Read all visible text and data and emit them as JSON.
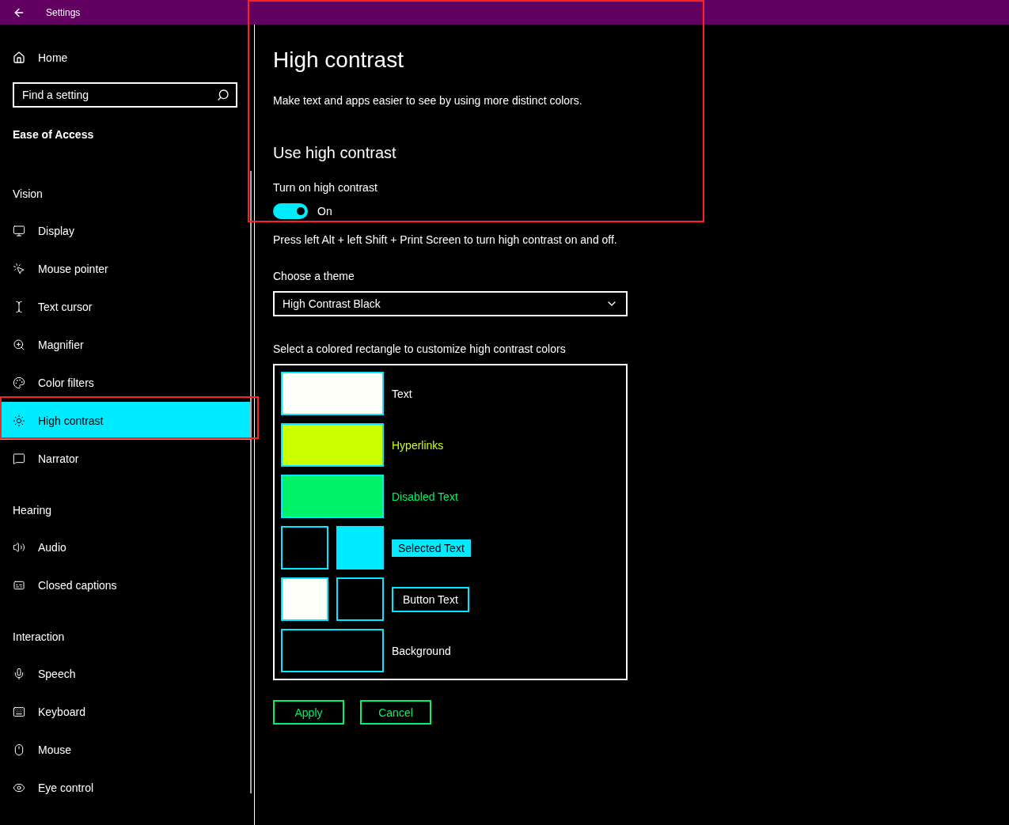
{
  "window": {
    "title": "Settings"
  },
  "sidebar": {
    "home": "Home",
    "search": {
      "placeholder": "Find a setting"
    },
    "category": "Ease of Access",
    "groups": [
      {
        "heading": "Vision",
        "items": [
          {
            "label": "Display",
            "selected": false
          },
          {
            "label": "Mouse pointer",
            "selected": false
          },
          {
            "label": "Text cursor",
            "selected": false
          },
          {
            "label": "Magnifier",
            "selected": false
          },
          {
            "label": "Color filters",
            "selected": false
          },
          {
            "label": "High contrast",
            "selected": true
          },
          {
            "label": "Narrator",
            "selected": false
          }
        ]
      },
      {
        "heading": "Hearing",
        "items": [
          {
            "label": "Audio",
            "selected": false
          },
          {
            "label": "Closed captions",
            "selected": false
          }
        ]
      },
      {
        "heading": "Interaction",
        "items": [
          {
            "label": "Speech",
            "selected": false
          },
          {
            "label": "Keyboard",
            "selected": false
          },
          {
            "label": "Mouse",
            "selected": false
          },
          {
            "label": "Eye control",
            "selected": false
          }
        ]
      }
    ]
  },
  "page": {
    "title": "High contrast",
    "description": "Make text and apps easier to see by using more distinct colors.",
    "section": "Use high contrast",
    "toggle": {
      "label": "Turn on high contrast",
      "on": true,
      "state_text": "On"
    },
    "hint": "Press left Alt + left Shift + Print Screen to turn high contrast on and off.",
    "theme": {
      "label": "Choose a theme",
      "value": "High Contrast Black"
    },
    "colors_label": "Select a colored rectangle to customize high contrast colors",
    "color_rows": [
      {
        "kind": "single",
        "label": "Text",
        "swatches": [
          {
            "color": "#fffffa"
          }
        ]
      },
      {
        "kind": "single",
        "label": "Hyperlinks",
        "swatches": [
          {
            "color": "#ccff00"
          }
        ]
      },
      {
        "kind": "single",
        "label": "Disabled Text",
        "swatches": [
          {
            "color": "#00f268"
          }
        ]
      },
      {
        "kind": "selected",
        "label": "Selected Text",
        "swatches": [
          {
            "color": "#000000"
          },
          {
            "color": "#00ebff"
          }
        ]
      },
      {
        "kind": "button",
        "label": "Button Text",
        "swatches": [
          {
            "color": "#fffffa"
          },
          {
            "color": "#000000"
          }
        ]
      },
      {
        "kind": "single",
        "label": "Background",
        "swatches": [
          {
            "color": "#000000"
          }
        ]
      }
    ],
    "buttons": [
      "Apply",
      "Cancel"
    ]
  }
}
